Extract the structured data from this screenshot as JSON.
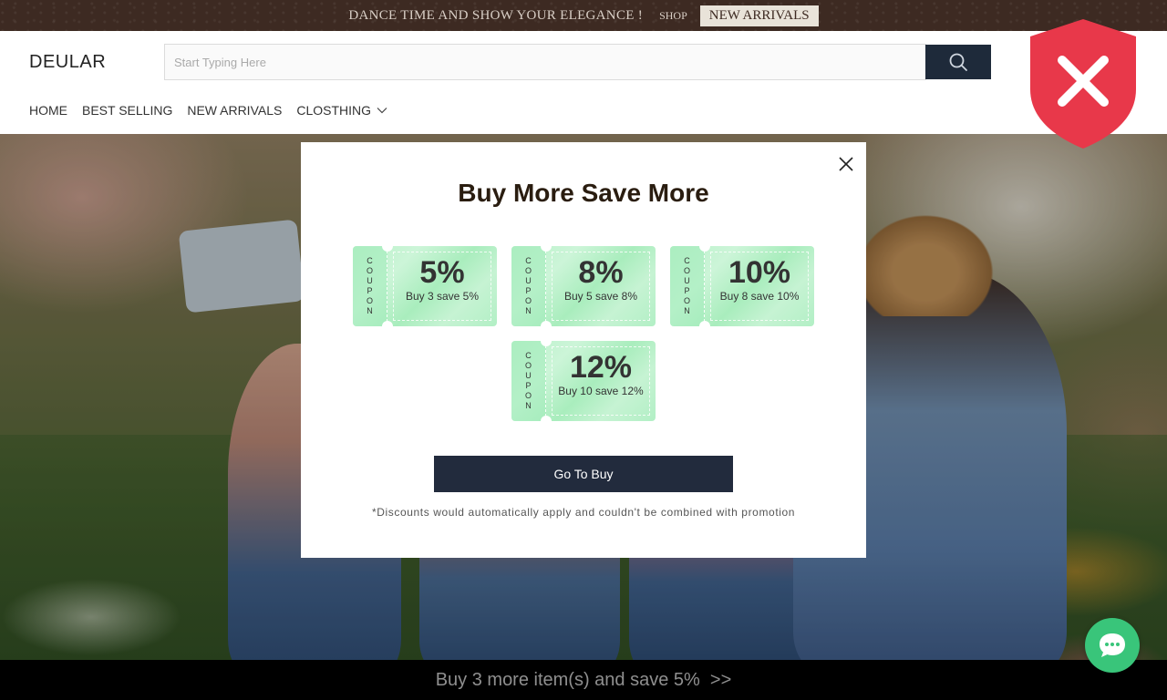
{
  "announcement": {
    "message": "DANCE TIME AND SHOW YOUR ELEGANCE !",
    "shop_label": "SHOP",
    "badge": "NEW ARRIVALS"
  },
  "header": {
    "logo": "DEULAR",
    "search_placeholder": "Start Typing Here",
    "search_icon": "search-icon",
    "nav": [
      "HOME",
      "BEST SELLING",
      "NEW ARRIVALS",
      "CLOSTHING"
    ]
  },
  "shield_icon": "shield-x-icon",
  "modal": {
    "title": "Buy More Save More",
    "coupon_label": "COUPON",
    "coupons": [
      {
        "percent": "5%",
        "desc": "Buy 3 save 5%"
      },
      {
        "percent": "8%",
        "desc": "Buy 5 save 8%"
      },
      {
        "percent": "10%",
        "desc": "Buy 8 save 10%"
      },
      {
        "percent": "12%",
        "desc": "Buy 10 save 12%"
      }
    ],
    "button": "Go To Buy",
    "disclaimer": "*Discounts would automatically apply and couldn't be combined with promotion"
  },
  "bottom_bar": "Buy 3 more item(s) and save 5%  >>",
  "colors": {
    "topbar": "#3d2a22",
    "search_button": "#1e2a3a",
    "shield": "#e8384a",
    "coupon": "#b9f1c9",
    "primary_button": "#222b3d",
    "chat": "#39c57a"
  }
}
